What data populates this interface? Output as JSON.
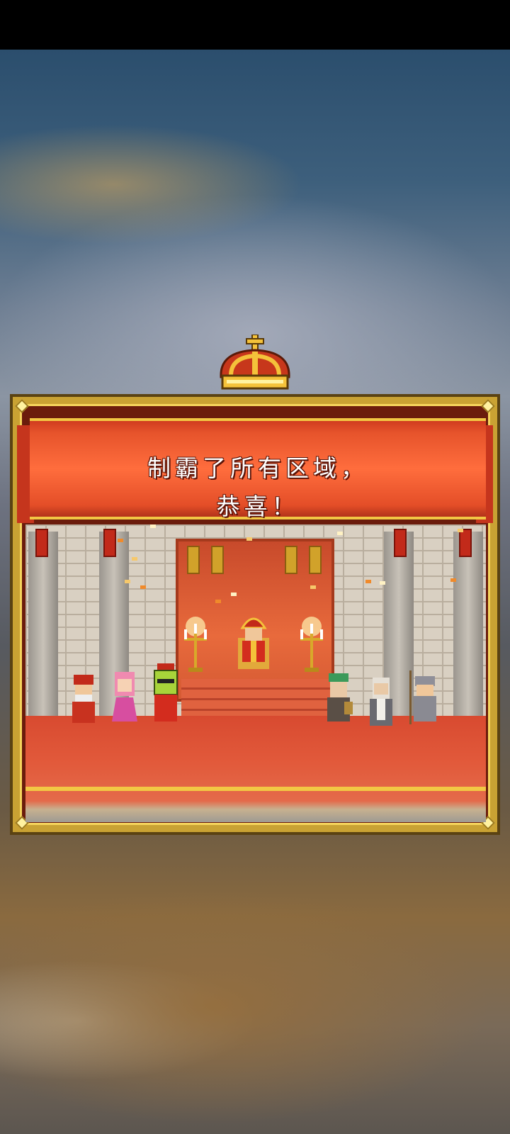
{
  "screen": {
    "message_line_1": "制霸了所有区域，",
    "message_line_2": "恭喜！"
  },
  "colors": {
    "banner": "#ff6d3d",
    "frame_gold": "#c9a233",
    "crown_red": "#c7371b",
    "carpet": "#e25a3b"
  },
  "icons": {
    "crown": "crown-icon"
  }
}
